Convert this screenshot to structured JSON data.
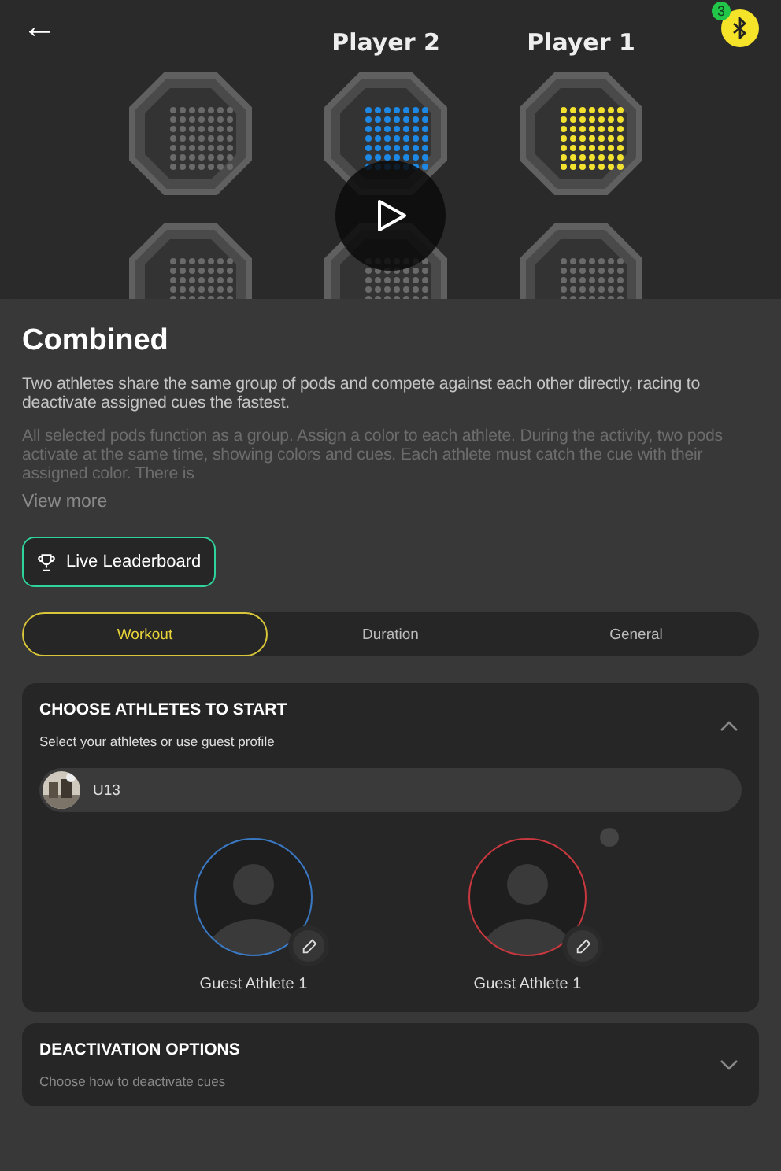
{
  "header": {
    "back": "←",
    "players": [
      "Player 2",
      "Player 1"
    ],
    "bluetooth_count": "3"
  },
  "pods": [
    {
      "color": "#6a6a6a"
    },
    {
      "color": "#1e88e5"
    },
    {
      "color": "#f2e12e"
    },
    {
      "color": "#6a6a6a"
    },
    {
      "color": "#6a6a6a"
    },
    {
      "color": "#6a6a6a"
    }
  ],
  "activity": {
    "title": "Combined",
    "description": "Two athletes share the same group of pods and compete against each other directly, racing to deactivate assigned cues the fastest.",
    "details": "All selected pods function as a group. Assign a color to each athlete. During the activity, two pods activate at the same time, showing colors and cues. Each athlete must catch the cue with their assigned color. There is",
    "view_more": "View more"
  },
  "leaderboard_button": "Live Leaderboard",
  "tabs": [
    {
      "label": "Workout",
      "selected": true
    },
    {
      "label": "Duration",
      "selected": false
    },
    {
      "label": "General",
      "selected": false
    }
  ],
  "sections": [
    {
      "title": "CHOOSE ATHLETES TO START",
      "subtitle": "Select your athletes or use guest profile",
      "expanded": true,
      "team": "U13",
      "athletes": [
        {
          "name": "Guest Athlete 1",
          "color": "#3a78c2"
        },
        {
          "name": "Guest Athlete 1",
          "color": "#c8383f"
        }
      ]
    },
    {
      "title": "DEACTIVATION OPTIONS",
      "subtitle": "Choose how to deactivate cues",
      "expanded": false
    }
  ]
}
